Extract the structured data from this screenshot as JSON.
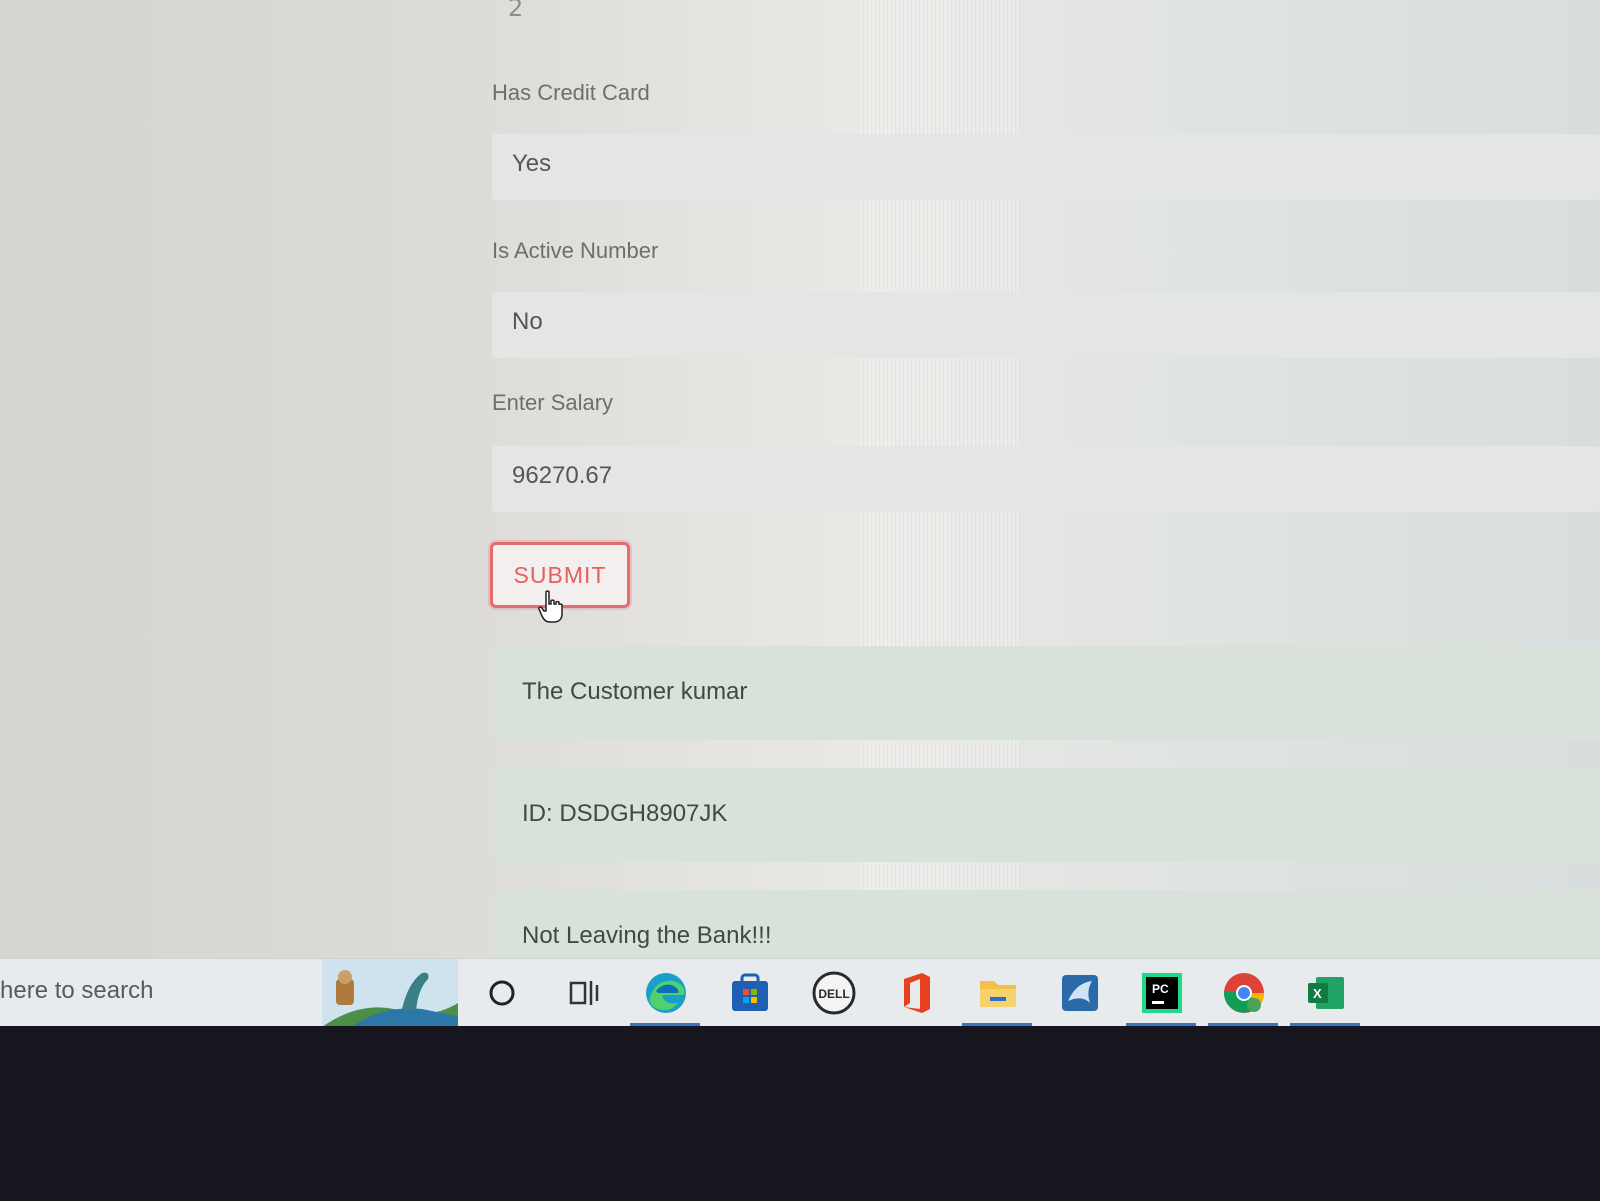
{
  "form": {
    "top_fragment": "2",
    "fields": [
      {
        "label": "Has Credit Card",
        "value": "Yes"
      },
      {
        "label": "Is Active Number",
        "value": "No"
      },
      {
        "label": "Enter Salary",
        "value": "96270.67"
      }
    ],
    "submit_label": "SUBMIT"
  },
  "results": [
    "The Customer kumar",
    "ID: DSDGH8907JK",
    "Not Leaving the Bank!!!"
  ],
  "taskbar": {
    "search_text": "here to search",
    "icons": [
      "cortana-icon",
      "task-view-icon",
      "edge-icon",
      "store-icon",
      "dell-icon",
      "office-icon",
      "file-explorer-icon",
      "mysql-workbench-icon",
      "pycharm-icon",
      "chrome-icon",
      "excel-icon"
    ],
    "pycharm_badge": "PC",
    "excel_badge": "X",
    "dell_badge": "DELL"
  },
  "colors": {
    "submit_border": "#e56c6c",
    "result_bg": "#d8e2db",
    "field_bg": "#e4e6e6",
    "taskbar_active": "#3a74c8"
  }
}
